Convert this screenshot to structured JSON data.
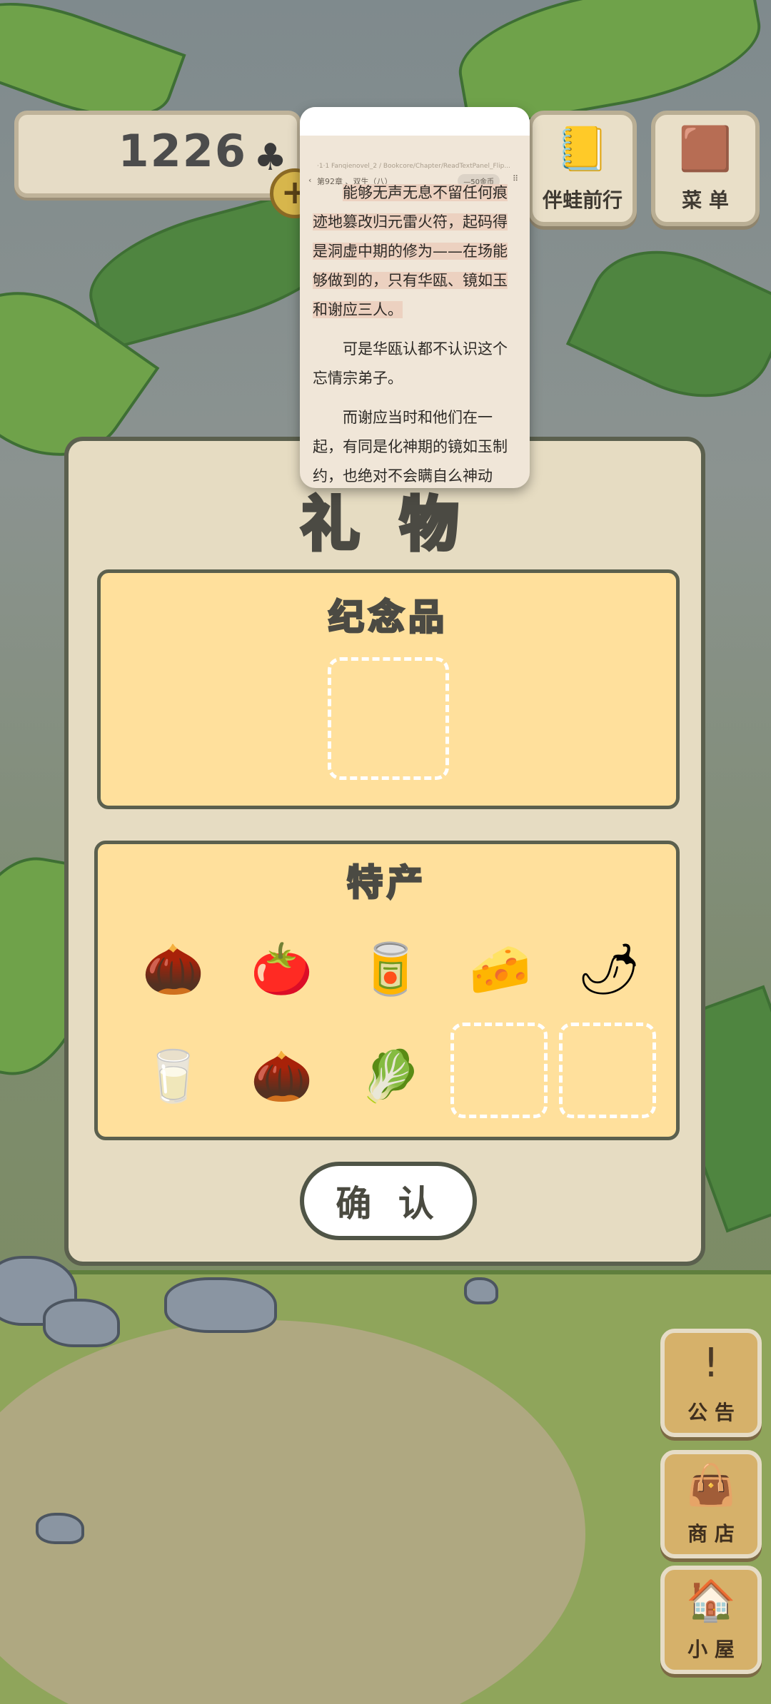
{
  "counter": {
    "value": "1226"
  },
  "top_buttons": [
    {
      "label": "伴蛙前行",
      "icon": "journey-icon"
    },
    {
      "label": "菜 单",
      "icon": "menu-icon"
    }
  ],
  "side_buttons": [
    {
      "label": "公 告",
      "icon": "exclamation-icon"
    },
    {
      "label": "商 店",
      "icon": "bag-icon"
    },
    {
      "label": "小 屋",
      "icon": "house-icon"
    }
  ],
  "gift_dialog": {
    "title": "礼 物",
    "souvenir": {
      "title": "纪念品"
    },
    "specialty": {
      "title": "特产",
      "items": [
        {
          "name": "chestnut",
          "glyph": "🌰"
        },
        {
          "name": "persimmon",
          "glyph": "🍅"
        },
        {
          "name": "tea-can",
          "glyph": "🥫"
        },
        {
          "name": "cheese",
          "glyph": "🧀"
        },
        {
          "name": "chili-pepper",
          "glyph": "🌶"
        },
        {
          "name": "milk-jug",
          "glyph": "🥛"
        },
        {
          "name": "chestnut",
          "glyph": "🌰"
        },
        {
          "name": "cabbage",
          "glyph": "🥬"
        }
      ],
      "empty_slots": 2
    },
    "confirm_label": "确 认"
  },
  "reader": {
    "chapter": "第92章 、双生（八）",
    "pill": "—50金币",
    "path_text": "·1·1 Fanqienovel_2 / Bookcore/Chapter/ReadTextPanel_Flip...",
    "paragraphs": [
      "能够无声无息不留任何痕迹地篡改归元雷火符，起码得是洞虚中期的修为——在场能够做到的，只有华瓯、镜如玉和谢应三人。",
      "可是华瓯认都不认识这个忘情宗弟子。",
      "而谢应当时和他们在一起，有同是化神期的镜如玉制约，也绝对不会瞒自么神动"
    ]
  }
}
